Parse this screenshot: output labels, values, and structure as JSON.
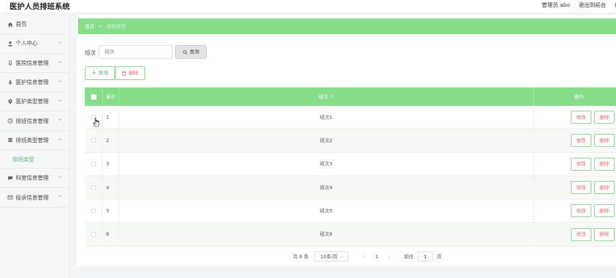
{
  "header": {
    "title": "医护人员排班系统",
    "admin_label": "管理员 abo",
    "exit_label": "退出到前台",
    "extra_label": "退"
  },
  "sidebar": {
    "items": [
      {
        "label": "首页",
        "icon": "home-icon",
        "has_chevron": false
      },
      {
        "label": "个人中心",
        "icon": "user-icon",
        "has_chevron": true
      },
      {
        "label": "医院信息管理",
        "icon": "info-icon",
        "has_chevron": true
      },
      {
        "label": "医护信息管理",
        "icon": "mic-icon",
        "has_chevron": true
      },
      {
        "label": "医护类型管理",
        "icon": "pin-icon",
        "has_chevron": true
      },
      {
        "label": "排班信息管理",
        "icon": "clock-icon",
        "has_chevron": true
      },
      {
        "label": "排班类型管理",
        "icon": "stack-icon",
        "has_chevron": true,
        "expanded": true
      },
      {
        "label": "科室信息管理",
        "icon": "chat-icon",
        "has_chevron": true
      },
      {
        "label": "投诉信息管理",
        "icon": "mail-icon",
        "has_chevron": true
      }
    ],
    "sub_item": "排班类型"
  },
  "breadcrumb": {
    "home": "首页",
    "separator": "→",
    "current": "排班类型"
  },
  "search": {
    "label": "班次",
    "placeholder": "班次",
    "button_label": "查询"
  },
  "actions": {
    "add_label": "新增",
    "delete_label": "删除"
  },
  "table": {
    "headers": {
      "index": "索引",
      "name": "班次",
      "operations": "操作"
    },
    "rows": [
      {
        "index": "1",
        "name": "班次1"
      },
      {
        "index": "2",
        "name": "班次2"
      },
      {
        "index": "3",
        "name": "班次3"
      },
      {
        "index": "4",
        "name": "班次4"
      },
      {
        "index": "5",
        "name": "班次5"
      },
      {
        "index": "6",
        "name": "班次6"
      }
    ],
    "edit_label": "修改",
    "delete_label": "删除"
  },
  "pagination": {
    "total": "共 6 条",
    "page_size": "10条/页",
    "prev": "‹",
    "current_page": "1",
    "next": "›",
    "goto_label": "前往",
    "goto_value": "1",
    "page_unit": "页"
  },
  "colors": {
    "accent": "#86dd8a",
    "danger_text": "#e06b6b"
  }
}
